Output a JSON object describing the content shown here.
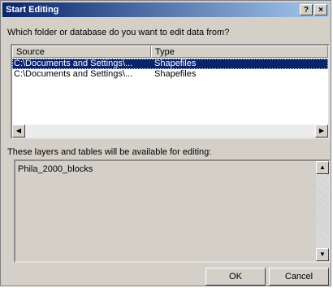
{
  "window": {
    "title": "Start Editing",
    "help_label": "?",
    "close_label": "×"
  },
  "prompt": "Which folder or database do you want to edit data from?",
  "table": {
    "columns": [
      "Source",
      "Type"
    ],
    "rows": [
      {
        "source": "C:\\Documents and Settings\\...",
        "type": "Shapefiles",
        "selected": true
      },
      {
        "source": "C:\\Documents and Settings\\...",
        "type": "Shapefiles",
        "selected": false
      }
    ]
  },
  "layers_label": "These layers and tables will be available for editing:",
  "layers": [
    "Phila_2000_blocks"
  ],
  "buttons": {
    "ok": "OK",
    "cancel": "Cancel"
  },
  "colors": {
    "selection": "#0a246a",
    "dialog_bg": "#d4d0c8"
  },
  "icons": {
    "scroll_left": "◀",
    "scroll_right": "▶",
    "scroll_up": "▲",
    "scroll_down": "▼"
  }
}
